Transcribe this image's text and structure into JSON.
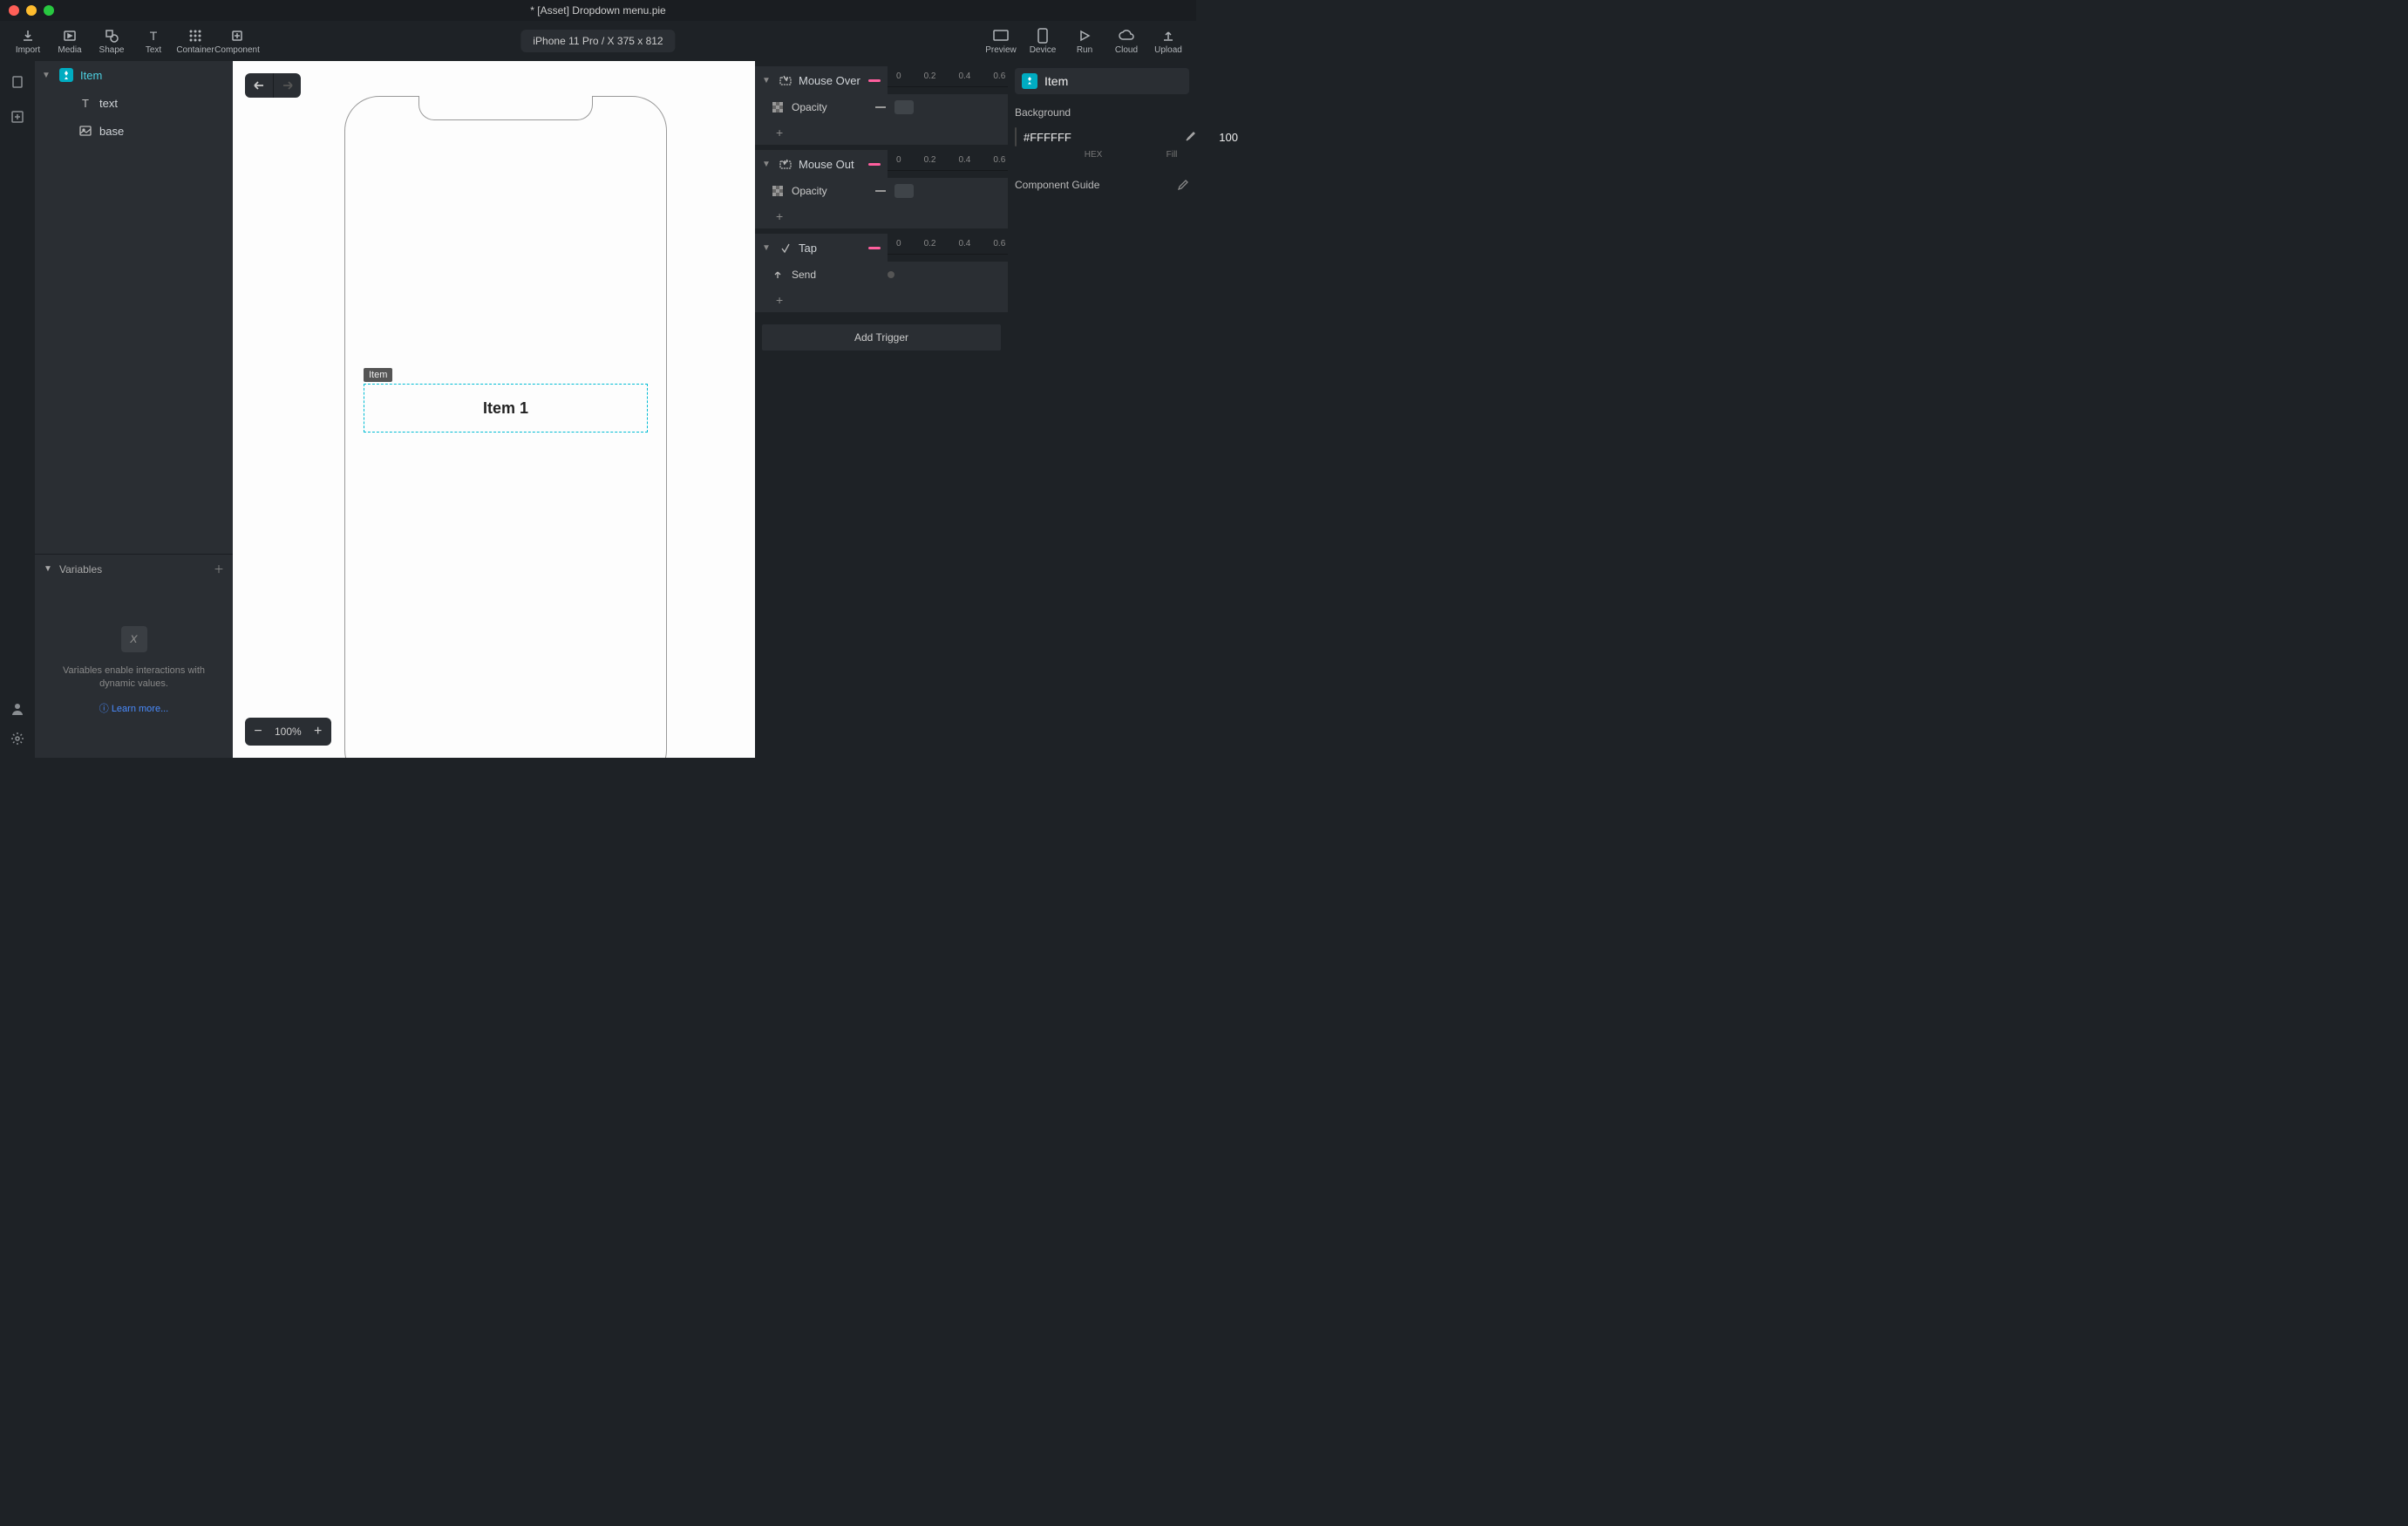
{
  "window": {
    "title": "* [Asset] Dropdown menu.pie"
  },
  "toolbar": {
    "left": [
      {
        "label": "Import",
        "icon": "import"
      },
      {
        "label": "Media",
        "icon": "media"
      },
      {
        "label": "Shape",
        "icon": "shape"
      },
      {
        "label": "Text",
        "icon": "text"
      },
      {
        "label": "Container",
        "icon": "container"
      },
      {
        "label": "Component",
        "icon": "component"
      }
    ],
    "device": "iPhone 11 Pro / X  375 x 812",
    "right": [
      {
        "label": "Preview",
        "icon": "preview"
      },
      {
        "label": "Device",
        "icon": "device"
      },
      {
        "label": "Run",
        "icon": "run"
      },
      {
        "label": "Cloud",
        "icon": "cloud"
      },
      {
        "label": "Upload",
        "icon": "upload"
      }
    ]
  },
  "layers": {
    "root": {
      "name": "Item"
    },
    "children": [
      {
        "name": "text",
        "icon": "text"
      },
      {
        "name": "base",
        "icon": "image"
      }
    ]
  },
  "variables": {
    "header": "Variables",
    "empty_text": "Variables enable interactions with dynamic values.",
    "learn_more": "Learn more..."
  },
  "canvas": {
    "zoom": "100%",
    "selection_label": "Item",
    "item_text": "Item 1"
  },
  "triggers": {
    "ticks": [
      "0",
      "0.2",
      "0.4",
      "0.6"
    ],
    "blocks": [
      {
        "name": "Mouse Over",
        "icon": "mouseover",
        "actions": [
          {
            "name": "Opacity",
            "icon": "checker",
            "style": "chip"
          }
        ]
      },
      {
        "name": "Mouse Out",
        "icon": "mouseout",
        "actions": [
          {
            "name": "Opacity",
            "icon": "checker",
            "style": "chip"
          }
        ]
      },
      {
        "name": "Tap",
        "icon": "tap",
        "actions": [
          {
            "name": "Send",
            "icon": "send",
            "style": "dot"
          }
        ]
      }
    ],
    "add_trigger": "Add Trigger"
  },
  "inspector": {
    "title": "Item",
    "background_label": "Background",
    "hex": "#FFFFFF",
    "fill": "100",
    "hex_label": "HEX",
    "fill_label": "Fill",
    "guide": "Component Guide"
  }
}
